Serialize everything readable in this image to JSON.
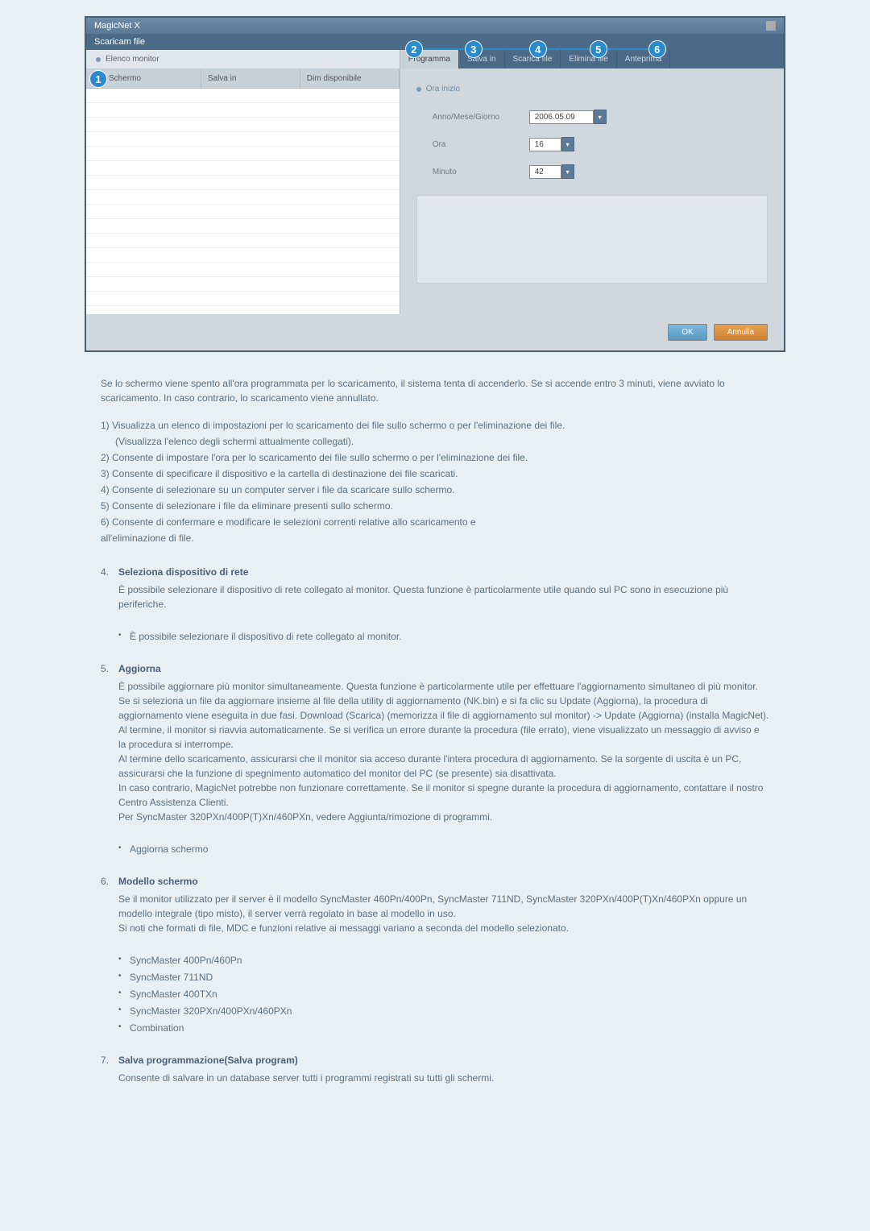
{
  "app": {
    "logo_text": "MagicNet X",
    "window_title": "Scaricam file",
    "left": {
      "monitor_list_label": "Elenco monitor",
      "columns": [
        "Schermo",
        "Salva in",
        "Dim disponibile"
      ]
    },
    "tabs": [
      "Programma",
      "Salva in",
      "Scarica file",
      "Elimina file",
      "Anteprima"
    ],
    "schedule": {
      "title": "Ora inizio",
      "rows": [
        {
          "label": "Anno/Mese/Giorno",
          "value": "2006.05.09"
        },
        {
          "label": "Ora",
          "value": "16"
        },
        {
          "label": "Minuto",
          "value": "42"
        }
      ]
    },
    "buttons": {
      "ok": "OK",
      "cancel": "Annulla"
    }
  },
  "circles": [
    "1",
    "2",
    "3",
    "4",
    "5",
    "6"
  ],
  "text": {
    "intro": "Se lo schermo viene spento all'ora programmata per lo scaricamento, il sistema tenta di accenderlo. Se si accende entro 3 minuti, viene avviato lo scaricamento. In caso contrario, lo scaricamento viene annullato.",
    "list_head": "1) Visualizza un elenco di impostazioni per lo scaricamento dei file sullo schermo o per l'eliminazione dei file.",
    "list_sub": "(Visualizza l'elenco degli schermi attualmente collegati).",
    "list2": "2) Consente di impostare l'ora per lo scaricamento dei file sullo schermo o per l'eliminazione dei file.",
    "list3": "3) Consente di specificare il dispositivo e la cartella di destinazione dei file scaricati.",
    "list4": "4) Consente di selezionare su un computer server i file da scaricare sullo schermo.",
    "list5": "5) Consente di selezionare i file da eliminare presenti sullo schermo.",
    "list6a": "6) Consente di confermare e modificare le selezioni correnti relative allo scaricamento e",
    "list6b": "all'eliminazione di file."
  },
  "sec4": {
    "num": "4.",
    "title": "Seleziona dispositivo di rete",
    "body": "È possibile selezionare il dispositivo di rete collegato al monitor. Questa funzione è particolarmente utile quando sul PC sono in esecuzione più periferiche.",
    "bullet": "È possibile selezionare il dispositivo di rete collegato al monitor."
  },
  "sec5": {
    "num": "5.",
    "title": "Aggiorna",
    "p1": "È possibile aggiornare più monitor simultaneamente. Questa funzione è particolarmente utile per effettuare l'aggiornamento simultaneo di più monitor.",
    "p2": "Se si seleziona un file da aggiornare insieme al file della utility di aggiornamento (NK.bin) e si fa clic su Update (Aggiorna), la procedura di aggiornamento viene eseguita in due fasi. Download (Scarica) (memorizza il file di aggiornamento sul monitor) -> Update (Aggiorna) (installa MagicNet).",
    "p3": "Al termine, il monitor si riavvia automaticamente. Se si verifica un errore durante la procedura (file errato), viene visualizzato un messaggio di avviso e la procedura si interrompe.",
    "p4": "Al termine dello scaricamento, assicurarsi che il monitor sia acceso durante l'intera procedura di aggiornamento. Se la sorgente di uscita è un PC, assicurarsi che la funzione di spegnimento automatico del monitor del PC (se presente) sia disattivata.",
    "p5": "In caso contrario, MagicNet potrebbe non funzionare correttamente. Se il monitor si spegne durante la procedura di aggiornamento, contattare il nostro Centro Assistenza Clienti.",
    "p6": "Per SyncMaster 320PXn/400P(T)Xn/460PXn, vedere Aggiunta/rimozione di programmi.",
    "bullet": "Aggiorna schermo"
  },
  "sec6": {
    "num": "6.",
    "title": "Modello schermo",
    "p1": "Se il monitor utilizzato per il server è il modello SyncMaster 460Pn/400Pn, SyncMaster 711ND, SyncMaster 320PXn/400P(T)Xn/460PXn oppure un modello integrale (tipo misto), il server verrà regolato in base al modello in uso.",
    "p2": "Si noti che formati di file, MDC e funzioni relative ai messaggi variano a seconda del modello selezionato.",
    "bullets": [
      "SyncMaster 400Pn/460Pn",
      "SyncMaster 711ND",
      "SyncMaster 400TXn",
      "SyncMaster 320PXn/400PXn/460PXn",
      "Combination"
    ]
  },
  "sec7": {
    "num": "7.",
    "title": "Salva programmazione(Salva program)",
    "body": "Consente di salvare in un database server tutti i programmi registrati su tutti gli schermi."
  }
}
